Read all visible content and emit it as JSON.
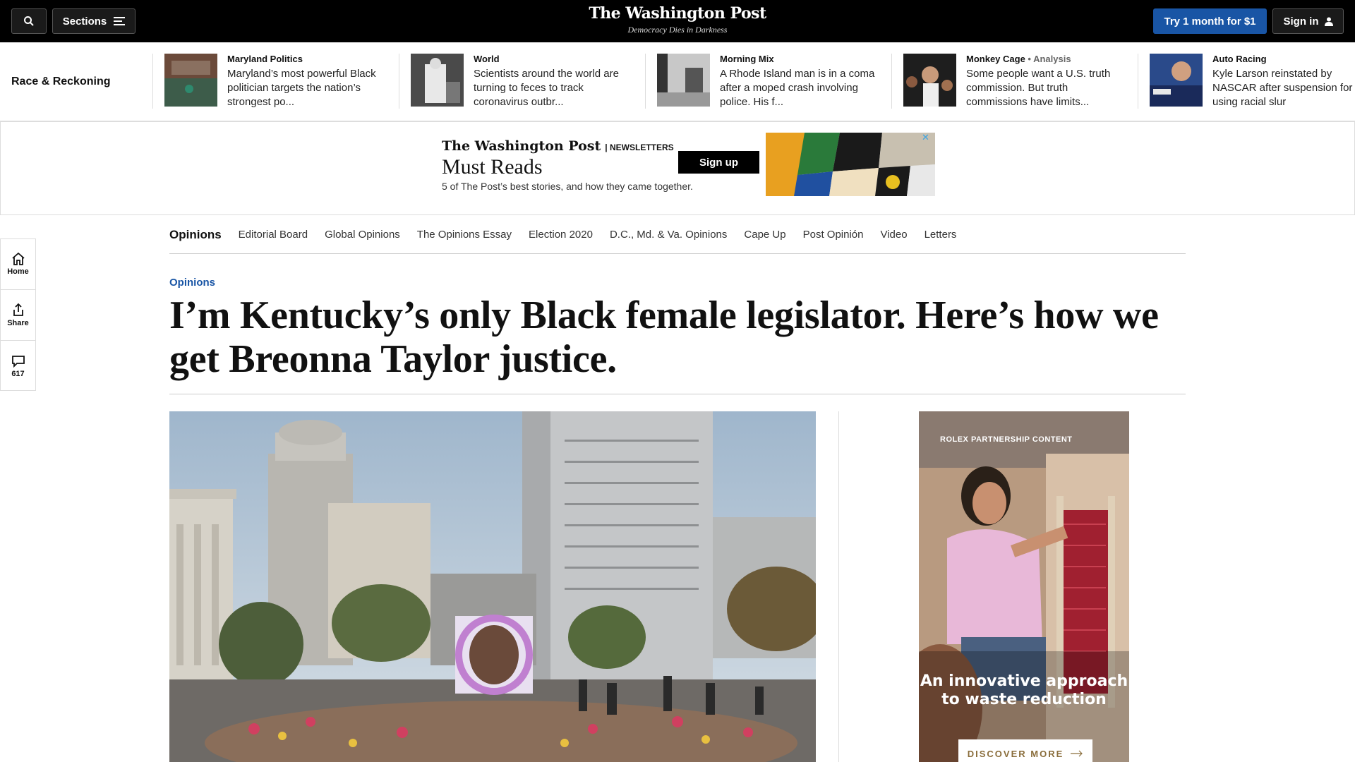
{
  "topbar": {
    "sections_label": "Sections",
    "logo_name": "The Washington Post",
    "logo_tagline": "Democracy Dies in Darkness",
    "try_label": "Try 1 month for $1",
    "signin_label": "Sign in"
  },
  "strip": {
    "title": "Race & Reckoning",
    "stories": [
      {
        "kicker": "Maryland Politics",
        "analysis": "",
        "headline": "Maryland’s most powerful Black politician targets the nation’s strongest po..."
      },
      {
        "kicker": "World",
        "analysis": "",
        "headline": "Scientists around the world are turning to feces to track coronavirus outbr..."
      },
      {
        "kicker": "Morning Mix",
        "analysis": "",
        "headline": "A Rhode Island man is in a coma after a moped crash involving police. His f..."
      },
      {
        "kicker": "Monkey Cage",
        "analysis": " • Analysis",
        "headline": "Some people want a U.S. truth commission. But truth commissions have limits..."
      },
      {
        "kicker": "Auto Racing",
        "analysis": "",
        "headline": "Kyle Larson reinstated by NASCAR after suspension for using racial slur"
      }
    ]
  },
  "newsletter_ad": {
    "logo": "The Washington Post",
    "section": "| NEWSLETTERS",
    "title": "Must Reads",
    "subtitle": "5 of The Post’s best stories, and how they came together.",
    "button": "Sign up",
    "close": "✕"
  },
  "rail": {
    "home": "Home",
    "share": "Share",
    "comments": "617"
  },
  "opinions_nav": {
    "main": "Opinions",
    "items": [
      "Editorial Board",
      "Global Opinions",
      "The Opinions Essay",
      "Election 2020",
      "D.C., Md. & Va. Opinions",
      "Cape Up",
      "Post Opinión",
      "Video",
      "Letters"
    ]
  },
  "article": {
    "kicker": "Opinions",
    "headline": "I’m Kentucky’s only Black female legislator. Here’s how we get Breonna Taylor justice."
  },
  "side_ad": {
    "tag": "ROLEX PARTNERSHIP CONTENT",
    "promo": "An innovative approach to waste reduction",
    "cta": "DISCOVER MORE"
  },
  "colors": {
    "accent_blue": "#1955a5",
    "topbar": "#000000"
  }
}
